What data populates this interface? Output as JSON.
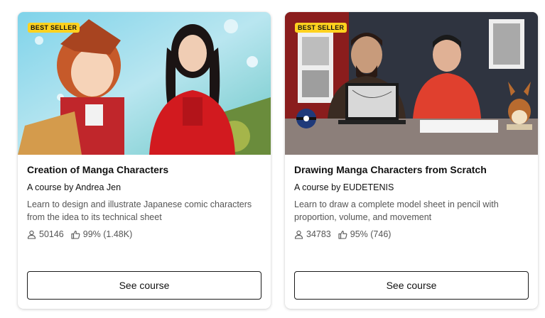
{
  "courses": [
    {
      "badge": "BEST SELLER",
      "title": "Creation of Manga Characters",
      "byline": "A course by Andrea Jen",
      "description": "Learn to design and illustrate Japanese comic characters from the idea to its technical sheet",
      "students": "50146",
      "rating": "99% (1.48K)",
      "button": "See course"
    },
    {
      "badge": "BEST SELLER",
      "title": "Drawing Manga Characters from Scratch",
      "byline": "A course by EUDETENIS",
      "description": "Learn to draw a complete model sheet in pencil with proportion, volume, and movement",
      "students": "34783",
      "rating": "95% (746)",
      "button": "See course"
    }
  ],
  "colors": {
    "badge": "#ffd21f",
    "button_border": "#1a1a1a"
  }
}
